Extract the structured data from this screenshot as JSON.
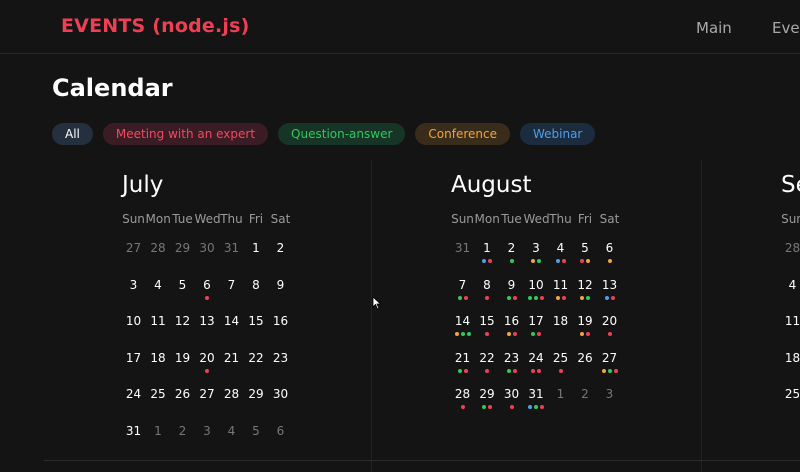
{
  "app": {
    "title": "EVENTS (node.js)"
  },
  "nav": [
    {
      "label": "Main"
    },
    {
      "label": "Ever"
    }
  ],
  "page_title": "Calendar",
  "filters": [
    {
      "label": "All",
      "cls": "chip-all"
    },
    {
      "label": "Meeting with an expert",
      "cls": "chip-meet"
    },
    {
      "label": "Question-answer",
      "cls": "chip-qa"
    },
    {
      "label": "Conference",
      "cls": "chip-conf"
    },
    {
      "label": "Webinar",
      "cls": "chip-web"
    }
  ],
  "colors": {
    "meet": "#ee4055",
    "qa": "#2dca5c",
    "conf": "#f2a53a",
    "web": "#4f9ee8"
  },
  "weekdays": [
    "Sun",
    "Mon",
    "Tue",
    "Wed",
    "Thu",
    "Fri",
    "Sat"
  ],
  "months": [
    {
      "name": "July",
      "weeks": [
        [
          {
            "d": "27",
            "m": true
          },
          {
            "d": "28",
            "m": true
          },
          {
            "d": "29",
            "m": true
          },
          {
            "d": "30",
            "m": true
          },
          {
            "d": "31",
            "m": true
          },
          {
            "d": "1"
          },
          {
            "d": "2"
          }
        ],
        [
          {
            "d": "3"
          },
          {
            "d": "4"
          },
          {
            "d": "5"
          },
          {
            "d": "6",
            "e": [
              "meet"
            ]
          },
          {
            "d": "7"
          },
          {
            "d": "8"
          },
          {
            "d": "9"
          }
        ],
        [
          {
            "d": "10"
          },
          {
            "d": "11"
          },
          {
            "d": "12"
          },
          {
            "d": "13"
          },
          {
            "d": "14"
          },
          {
            "d": "15"
          },
          {
            "d": "16"
          }
        ],
        [
          {
            "d": "17"
          },
          {
            "d": "18"
          },
          {
            "d": "19"
          },
          {
            "d": "20",
            "e": [
              "meet"
            ]
          },
          {
            "d": "21"
          },
          {
            "d": "22"
          },
          {
            "d": "23"
          }
        ],
        [
          {
            "d": "24"
          },
          {
            "d": "25"
          },
          {
            "d": "26"
          },
          {
            "d": "27"
          },
          {
            "d": "28"
          },
          {
            "d": "29"
          },
          {
            "d": "30"
          }
        ],
        [
          {
            "d": "31"
          },
          {
            "d": "1",
            "m": true
          },
          {
            "d": "2",
            "m": true
          },
          {
            "d": "3",
            "m": true
          },
          {
            "d": "4",
            "m": true
          },
          {
            "d": "5",
            "m": true
          },
          {
            "d": "6",
            "m": true
          }
        ]
      ]
    },
    {
      "name": "August",
      "weeks": [
        [
          {
            "d": "31",
            "m": true
          },
          {
            "d": "1",
            "e": [
              "web",
              "meet"
            ]
          },
          {
            "d": "2",
            "e": [
              "qa"
            ]
          },
          {
            "d": "3",
            "e": [
              "conf",
              "qa"
            ]
          },
          {
            "d": "4",
            "e": [
              "web",
              "meet"
            ]
          },
          {
            "d": "5",
            "e": [
              "meet",
              "conf"
            ]
          },
          {
            "d": "6",
            "e": [
              "conf"
            ]
          }
        ],
        [
          {
            "d": "7",
            "e": [
              "qa",
              "meet"
            ]
          },
          {
            "d": "8",
            "e": [
              "meet"
            ]
          },
          {
            "d": "9",
            "e": [
              "qa",
              "meet"
            ]
          },
          {
            "d": "10",
            "e": [
              "qa",
              "qa",
              "meet"
            ]
          },
          {
            "d": "11",
            "e": [
              "conf",
              "meet"
            ]
          },
          {
            "d": "12",
            "e": [
              "conf",
              "qa"
            ]
          },
          {
            "d": "13",
            "e": [
              "web",
              "meet"
            ]
          }
        ],
        [
          {
            "d": "14",
            "e": [
              "conf",
              "qa",
              "qa"
            ]
          },
          {
            "d": "15",
            "e": [
              "meet"
            ]
          },
          {
            "d": "16",
            "e": [
              "conf",
              "meet"
            ]
          },
          {
            "d": "17",
            "e": [
              "qa",
              "meet"
            ]
          },
          {
            "d": "18"
          },
          {
            "d": "19",
            "e": [
              "conf",
              "meet"
            ]
          },
          {
            "d": "20",
            "e": [
              "meet"
            ]
          }
        ],
        [
          {
            "d": "21",
            "e": [
              "qa",
              "meet"
            ]
          },
          {
            "d": "22",
            "e": [
              "meet"
            ]
          },
          {
            "d": "23",
            "e": [
              "qa",
              "meet"
            ]
          },
          {
            "d": "24",
            "e": [
              "meet",
              "meet"
            ]
          },
          {
            "d": "25",
            "e": [
              "meet"
            ]
          },
          {
            "d": "26"
          },
          {
            "d": "27",
            "e": [
              "conf",
              "qa",
              "meet"
            ]
          }
        ],
        [
          {
            "d": "28",
            "e": [
              "meet"
            ]
          },
          {
            "d": "29",
            "e": [
              "qa",
              "meet"
            ]
          },
          {
            "d": "30",
            "e": [
              "meet"
            ]
          },
          {
            "d": "31",
            "e": [
              "web",
              "qa",
              "meet"
            ]
          },
          {
            "d": "1",
            "m": true
          },
          {
            "d": "2",
            "m": true
          },
          {
            "d": "3",
            "m": true
          }
        ]
      ]
    },
    {
      "name": "Se",
      "weeks": [
        [
          {
            "d": "28",
            "m": true
          }
        ],
        [
          {
            "d": "4"
          }
        ],
        [
          {
            "d": "11"
          }
        ],
        [
          {
            "d": "18"
          }
        ],
        [
          {
            "d": "25"
          }
        ]
      ]
    }
  ],
  "partial_weekday": "Sun"
}
